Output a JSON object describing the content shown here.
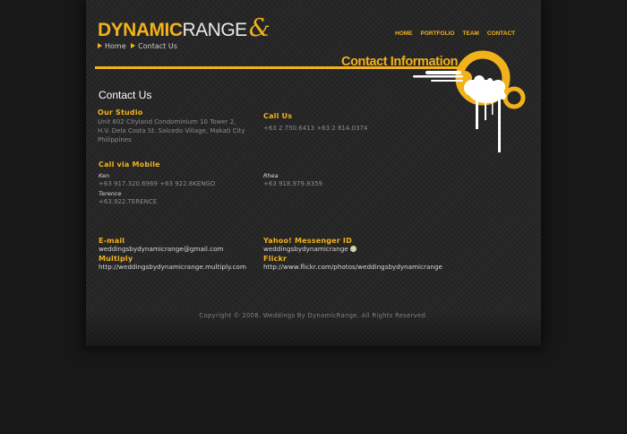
{
  "brand": {
    "part1": "DYNAMIC",
    "part2": "RANGE",
    "amp": "&"
  },
  "breadcrumb": {
    "home": "Home",
    "current": "Contact Us"
  },
  "nav": [
    "HOME",
    "PORTFOLIO",
    "TEAM",
    "CONTACT"
  ],
  "banner_title": "Contact Information",
  "heading": "Contact Us",
  "studio": {
    "title": "Our Studio",
    "lines": [
      "Unit 602 Cityland Condominium 10 Tower 2,",
      "H.V. Dela Costa St. Salcedo Village, Makati City",
      "Philippines"
    ]
  },
  "call": {
    "title": "Call Us",
    "numbers": "+63 2 750.6413   +63 2 814.0374"
  },
  "mobile": {
    "title": "Call via Mobile",
    "ken_name": "Ken",
    "ken_numbers": "+63 917.320.6969  +63 922.8KENGO",
    "rhea_name": "Rhea",
    "rhea_numbers": "+63 918.979.8359",
    "terence_name": "Terence",
    "terence_numbers": "+63.922.TERENCE"
  },
  "email": {
    "title": "E-mail",
    "value": "weddingsbydynamicrange@gmail.com"
  },
  "yahoo": {
    "title": "Yahoo! Messenger ID",
    "value": "weddingsbydynamicrange"
  },
  "multiply": {
    "title": "Multiply",
    "value": "http://weddingsbydynamicrange.multiply.com"
  },
  "flickr": {
    "title": "Flickr",
    "value": "http://www.flickr.com/photos/weddingsbydynamicrange"
  },
  "footer": "Copyright © 2008. Weddings By DynamicRange. All Rights Reserved.",
  "colors": {
    "accent": "#f2b21b",
    "page_bg": "#272727",
    "outer_bg": "#181818"
  }
}
